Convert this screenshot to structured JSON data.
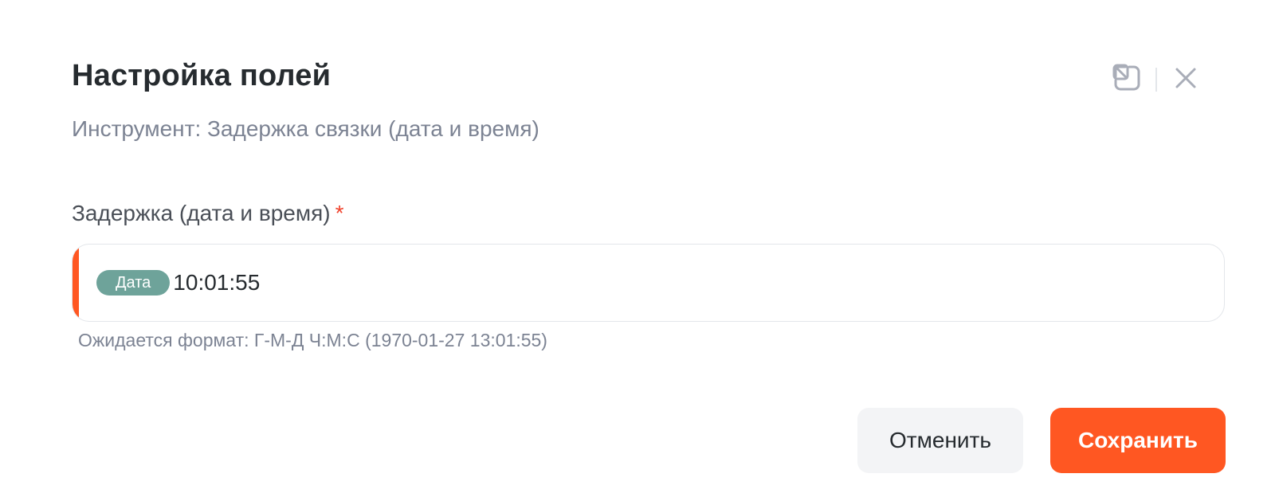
{
  "dialog": {
    "title": "Настройка полей",
    "subtitle": "Инструмент: Задержка связки (дата и время)",
    "header_icons": [
      "collapse-to-corner-icon",
      "close-icon"
    ]
  },
  "field": {
    "label": "Задержка (дата и время)",
    "required_mark": "*",
    "chip_label": "Дата",
    "value": "10:01:55",
    "hint": "Ожидается формат: Г-М-Д Ч:М:С (1970-01-27 13:01:55)"
  },
  "footer": {
    "cancel_label": "Отменить",
    "save_label": "Сохранить"
  },
  "colors": {
    "accent": "#ff5722",
    "chip": "#6ea39a",
    "required": "#f0442e"
  }
}
